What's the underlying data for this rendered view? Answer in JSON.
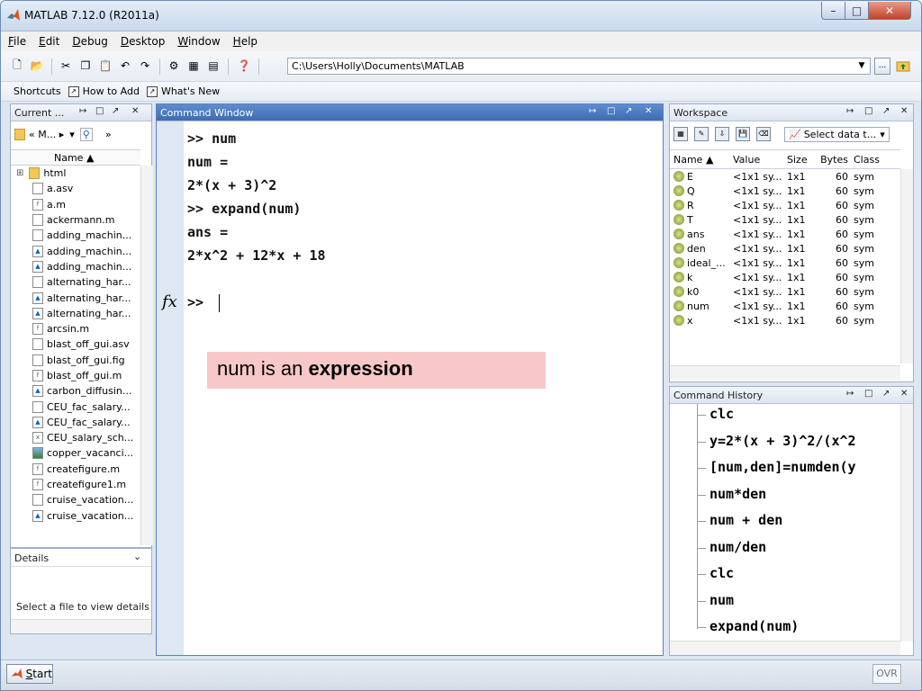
{
  "window": {
    "title": "MATLAB  7.12.0 (R2011a)"
  },
  "menu": [
    "File",
    "Edit",
    "Debug",
    "Desktop",
    "Window",
    "Help"
  ],
  "toolbar": {
    "path": "C:\\Users\\Holly\\Documents\\MATLAB",
    "browse_label": "..."
  },
  "shortcuts": {
    "items": [
      "Shortcuts",
      "How to Add",
      "What's New"
    ]
  },
  "current_folder": {
    "title": "Current ...",
    "nav_label": "« M... ▸",
    "column_header": "Name ▲",
    "files": [
      {
        "name": "html",
        "type": "folder"
      },
      {
        "name": "a.asv",
        "type": "file"
      },
      {
        "name": "a.m",
        "type": "mfunc"
      },
      {
        "name": "ackermann.m",
        "type": "file"
      },
      {
        "name": "adding_machin...",
        "type": "file"
      },
      {
        "name": "adding_machin...",
        "type": "mfig"
      },
      {
        "name": "adding_machin...",
        "type": "mfig"
      },
      {
        "name": "alternating_har...",
        "type": "file"
      },
      {
        "name": "alternating_har...",
        "type": "mfig"
      },
      {
        "name": "alternating_har...",
        "type": "mfig"
      },
      {
        "name": "arcsin.m",
        "type": "mfunc"
      },
      {
        "name": "blast_off_gui.asv",
        "type": "file"
      },
      {
        "name": "blast_off_gui.fig",
        "type": "file"
      },
      {
        "name": "blast_off_gui.m",
        "type": "mfunc"
      },
      {
        "name": "carbon_diffusin...",
        "type": "mfig"
      },
      {
        "name": "CEU_fac_salary...",
        "type": "file"
      },
      {
        "name": "CEU_fac_salary...",
        "type": "mfig"
      },
      {
        "name": "CEU_salary_sch...",
        "type": "xls"
      },
      {
        "name": "copper_vacanci...",
        "type": "img"
      },
      {
        "name": "createfigure.m",
        "type": "mfunc"
      },
      {
        "name": "createfigure1.m",
        "type": "mfunc"
      },
      {
        "name": "cruise_vacation...",
        "type": "file"
      },
      {
        "name": "cruise_vacation...",
        "type": "mfig"
      }
    ]
  },
  "details": {
    "title": "Details",
    "message": "Select a file to view details"
  },
  "command_window": {
    "title": "Command Window",
    "lines": [
      "&gt;&gt; num",
      "num =",
      "2*(x + 3)^2",
      "&gt;&gt; expand(num)",
      "ans =",
      "2*x^2 + 12*x + 18",
      "&gt;&gt; "
    ],
    "annotation_prefix": "num is an ",
    "annotation_bold": "expression"
  },
  "workspace": {
    "title": "Workspace",
    "select_label": "Select data t...",
    "columns": [
      "Name ▲",
      "Value",
      "Size",
      "Bytes",
      "Class"
    ],
    "rows": [
      {
        "name": "E",
        "value": "<1x1 sy...",
        "size": "1x1",
        "bytes": "60",
        "class": "sym"
      },
      {
        "name": "Q",
        "value": "<1x1 sy...",
        "size": "1x1",
        "bytes": "60",
        "class": "sym"
      },
      {
        "name": "R",
        "value": "<1x1 sy...",
        "size": "1x1",
        "bytes": "60",
        "class": "sym"
      },
      {
        "name": "T",
        "value": "<1x1 sy...",
        "size": "1x1",
        "bytes": "60",
        "class": "sym"
      },
      {
        "name": "ans",
        "value": "<1x1 sy...",
        "size": "1x1",
        "bytes": "60",
        "class": "sym"
      },
      {
        "name": "den",
        "value": "<1x1 sy...",
        "size": "1x1",
        "bytes": "60",
        "class": "sym"
      },
      {
        "name": "ideal_...",
        "value": "<1x1 sy...",
        "size": "1x1",
        "bytes": "60",
        "class": "sym"
      },
      {
        "name": "k",
        "value": "<1x1 sy...",
        "size": "1x1",
        "bytes": "60",
        "class": "sym"
      },
      {
        "name": "k0",
        "value": "<1x1 sy...",
        "size": "1x1",
        "bytes": "60",
        "class": "sym"
      },
      {
        "name": "num",
        "value": "<1x1 sy...",
        "size": "1x1",
        "bytes": "60",
        "class": "sym"
      },
      {
        "name": "x",
        "value": "<1x1 sy...",
        "size": "1x1",
        "bytes": "60",
        "class": "sym"
      }
    ]
  },
  "history": {
    "title": "Command History",
    "items": [
      "clc",
      "y=2*(x + 3)^2/(x^2",
      "[num,den]=numden(y",
      "num*den",
      "num + den",
      "num/den",
      "clc",
      "num",
      "expand(num)"
    ]
  },
  "status": {
    "start_label": "Start",
    "ovr": "OVR"
  }
}
